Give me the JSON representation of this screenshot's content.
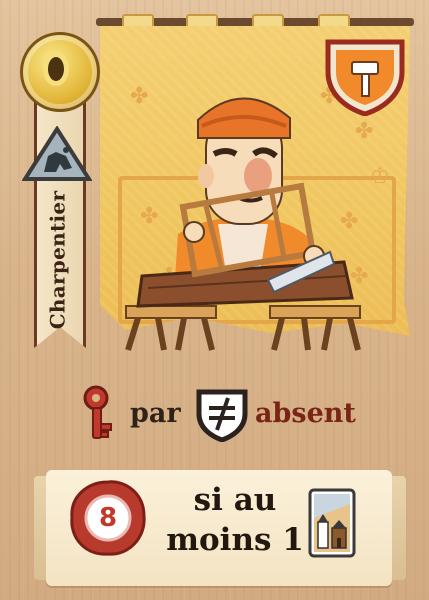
{
  "card": {
    "job_title": "Charpentier",
    "ability": {
      "prefix_word": "par",
      "suffix_word": "absent"
    },
    "condition": {
      "seal_value": "8",
      "line1": "si au",
      "line2": "moins 1"
    },
    "icons": {
      "coin": "gold-coin-icon",
      "role": "hand-triangle-icon",
      "shield": "hammer-shield-icon",
      "key": "key-icon",
      "gate": "crossed-gate-icon",
      "seal": "red-wax-seal-icon",
      "castle": "castle-card-icon"
    },
    "colors": {
      "tapestry": "#f0c65f",
      "banner_border": "#6a3a24",
      "accent_red": "#7a2418",
      "shield_orange": "#f08a2b",
      "seal_red": "#c0392b"
    }
  }
}
